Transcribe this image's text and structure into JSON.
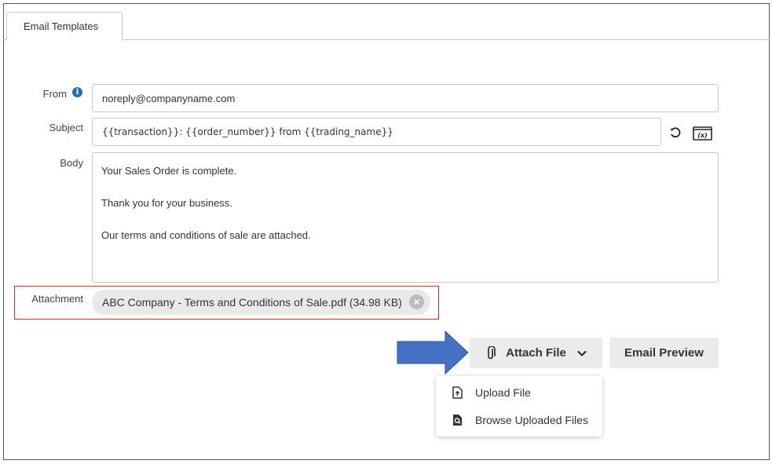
{
  "tabs": [
    {
      "label": "Email Templates"
    }
  ],
  "form": {
    "from_label": "From",
    "from_value": "noreply@companyname.com",
    "subject_label": "Subject",
    "subject_value": "{{transaction}}: {{order_number}} from {{trading_name}}",
    "body_label": "Body",
    "body_lines": [
      "Your Sales Order is complete.",
      "Thank you for your business.",
      "Our terms and conditions of sale are attached."
    ],
    "attachment_label": "Attachment",
    "attachment_file": "ABC Company - Terms and Conditions of Sale.pdf (34.98 KB)"
  },
  "buttons": {
    "attach_file": "Attach File",
    "email_preview": "Email Preview",
    "variables_icon_text": "(x)"
  },
  "attach_menu": {
    "items": [
      {
        "label": "Upload File",
        "icon": "upload-file-icon"
      },
      {
        "label": "Browse Uploaded Files",
        "icon": "browse-files-icon"
      }
    ]
  },
  "colors": {
    "info_icon": "#1f6fb5",
    "highlight_border": "#d9262b",
    "arrow_fill": "#4472c4",
    "button_bg": "#ebebeb"
  }
}
